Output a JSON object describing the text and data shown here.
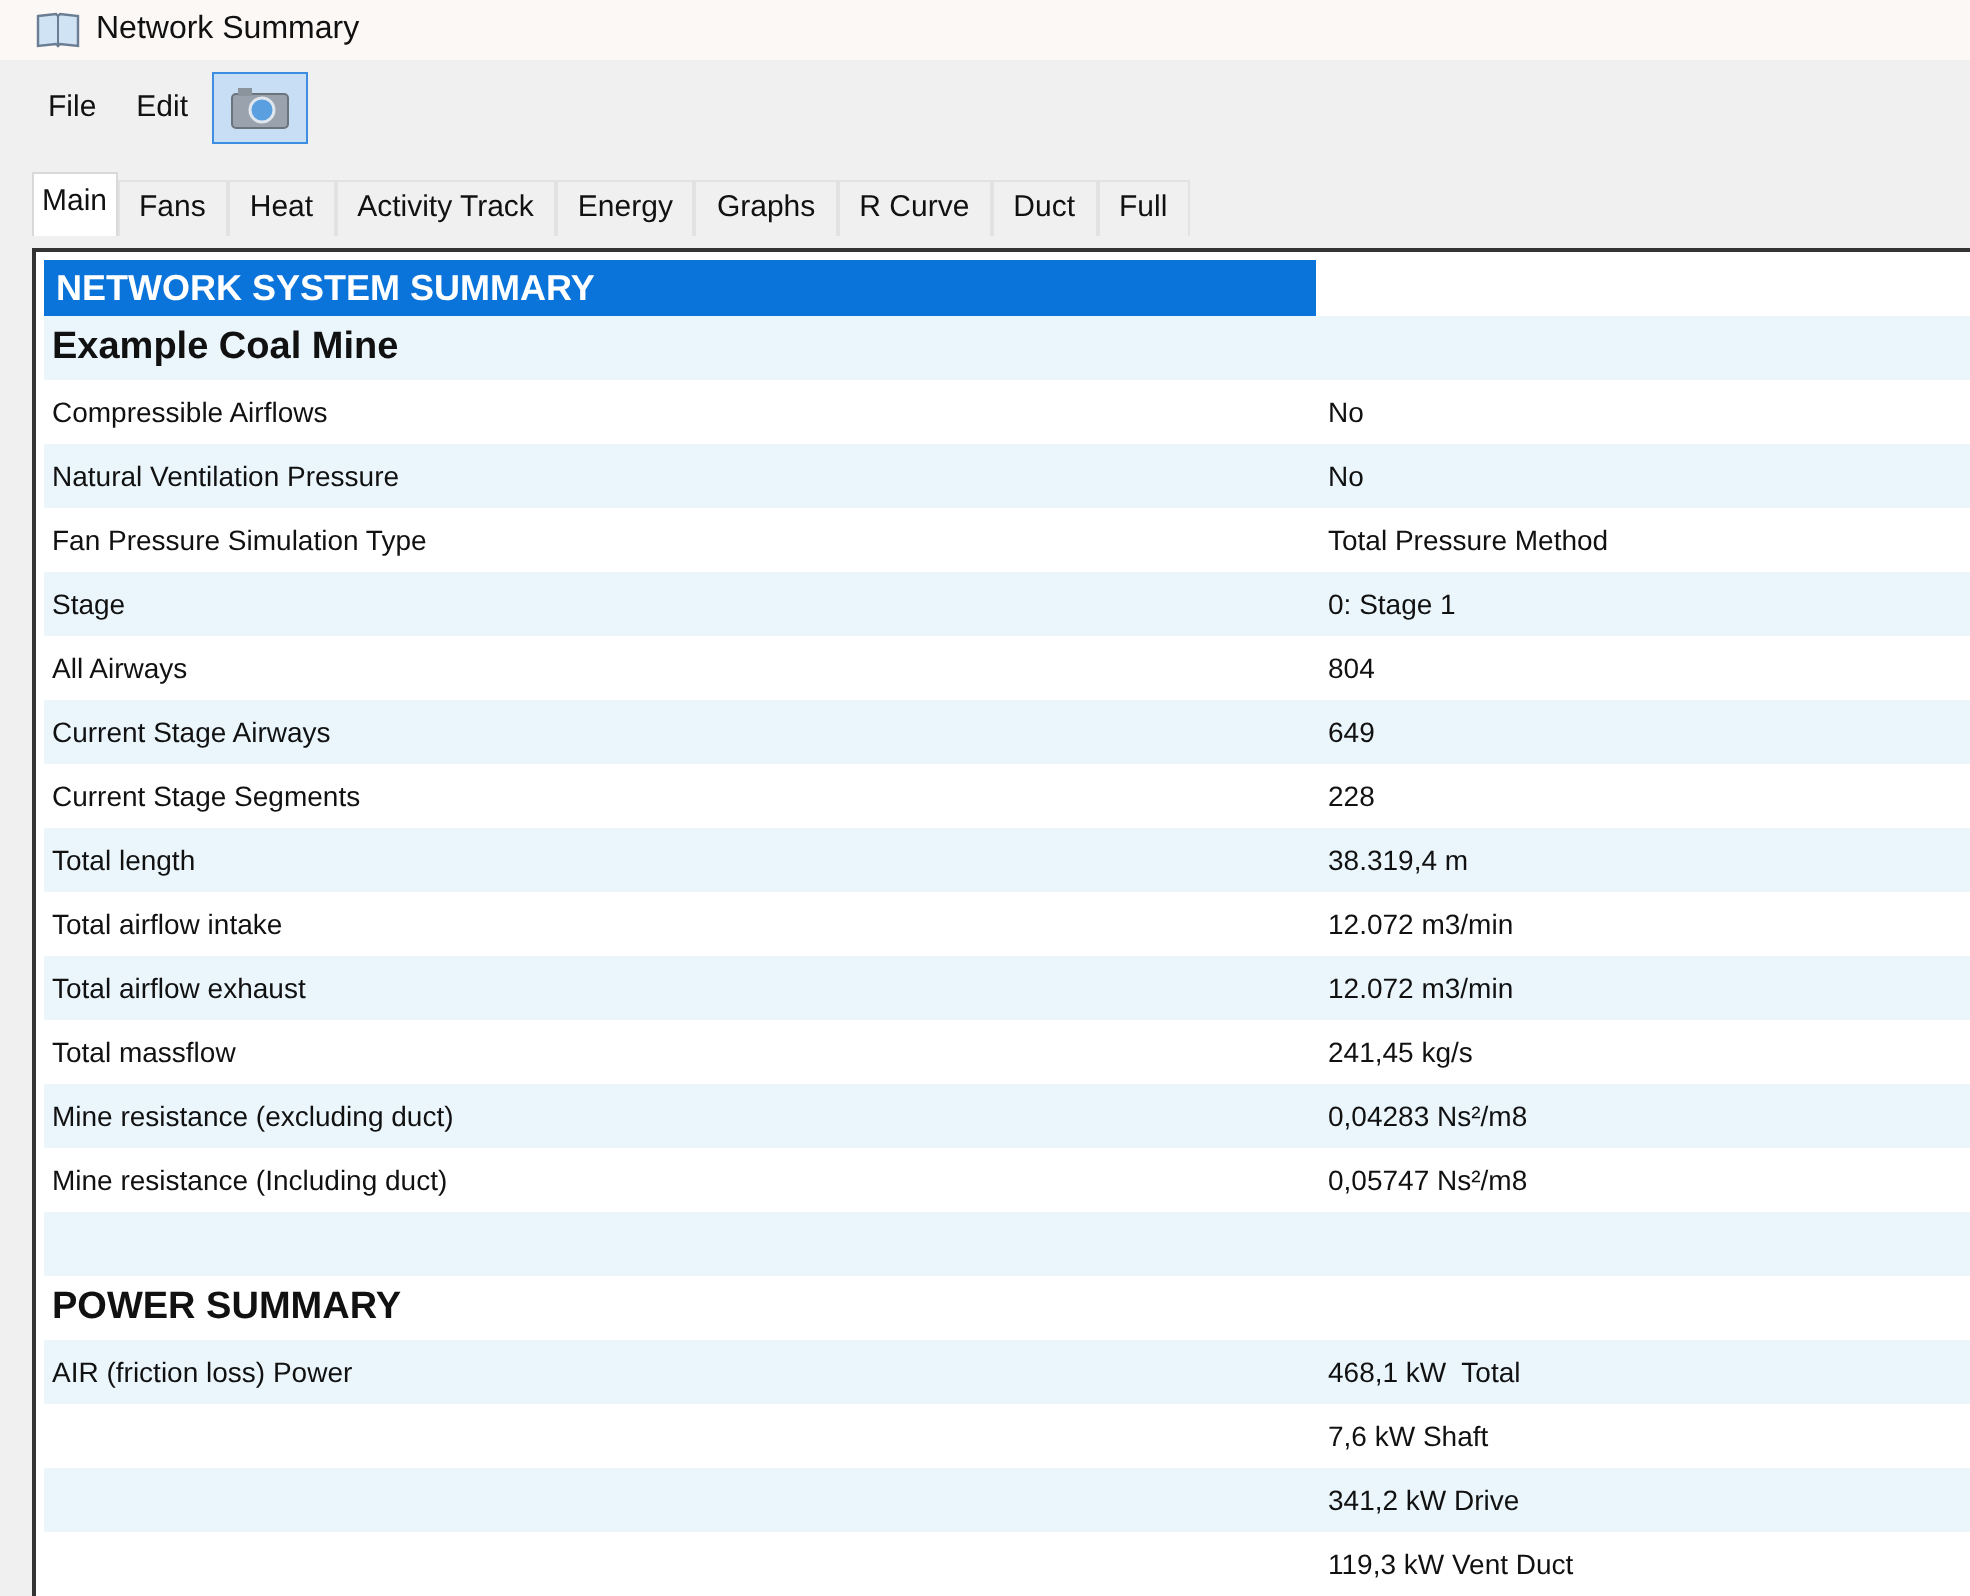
{
  "window": {
    "title": "Network Summary"
  },
  "menu": [
    "File",
    "Edit"
  ],
  "toolbar": {
    "camera_selected": true
  },
  "tabs": [
    {
      "label": "Main",
      "selected": true
    },
    {
      "label": "Fans",
      "selected": false
    },
    {
      "label": "Heat",
      "selected": false
    },
    {
      "label": "Activity Track",
      "selected": false
    },
    {
      "label": "Energy",
      "selected": false
    },
    {
      "label": "Graphs",
      "selected": false
    },
    {
      "label": "R Curve",
      "selected": false
    },
    {
      "label": "Duct",
      "selected": false
    },
    {
      "label": "Full",
      "selected": false
    }
  ],
  "summary": {
    "heading": "NETWORK SYSTEM SUMMARY",
    "rows": [
      {
        "kind": "section",
        "label": "Example Coal Mine"
      },
      {
        "kind": "item",
        "label": "Compressible Airflows",
        "value": "No"
      },
      {
        "kind": "item",
        "label": "Natural Ventilation Pressure",
        "value": "No"
      },
      {
        "kind": "item",
        "label": "Fan Pressure Simulation Type",
        "value": "Total Pressure Method"
      },
      {
        "kind": "item",
        "label": "Stage",
        "value": "0: Stage 1"
      },
      {
        "kind": "item",
        "label": "All Airways",
        "value": "804"
      },
      {
        "kind": "item",
        "label": "Current Stage Airways",
        "value": "649"
      },
      {
        "kind": "item",
        "label": "Current Stage Segments",
        "value": "228"
      },
      {
        "kind": "item",
        "label": "Total length",
        "value": "38.319,4 m"
      },
      {
        "kind": "item",
        "label": "Total airflow intake",
        "value": "12.072 m3/min"
      },
      {
        "kind": "item",
        "label": "Total airflow exhaust",
        "value": "12.072 m3/min"
      },
      {
        "kind": "item",
        "label": "Total massflow",
        "value": "241,45 kg/s"
      },
      {
        "kind": "item",
        "label": "Mine resistance (excluding duct)",
        "value": "0,04283 Ns²/m8"
      },
      {
        "kind": "item",
        "label": "Mine resistance (Including duct)",
        "value": "0,05747 Ns²/m8"
      },
      {
        "kind": "blank"
      },
      {
        "kind": "section",
        "label": "POWER SUMMARY"
      },
      {
        "kind": "item",
        "label": "AIR (friction loss) Power",
        "value": "468,1 kW  Total"
      },
      {
        "kind": "item",
        "value": "7,6 kW Shaft"
      },
      {
        "kind": "item",
        "value": "341,2 kW Drive"
      },
      {
        "kind": "item",
        "value": "119,3 kW Vent Duct"
      }
    ]
  }
}
